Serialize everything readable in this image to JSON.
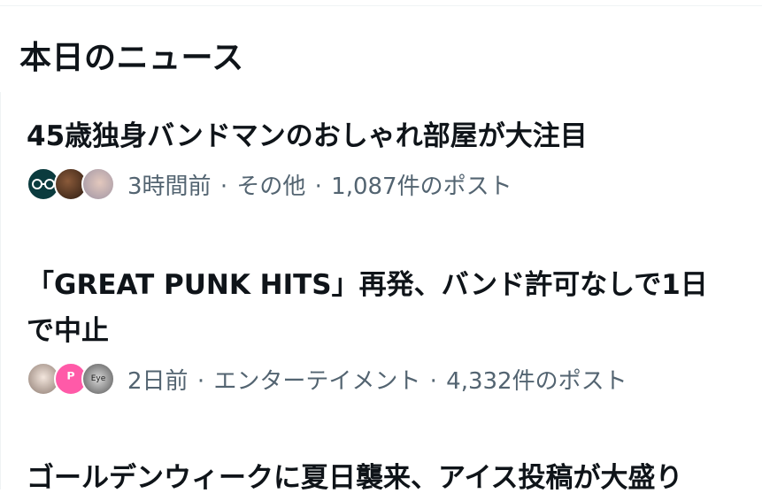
{
  "section": {
    "title": "本日のニュース"
  },
  "news": [
    {
      "headline_lines": [
        "45歳独身バンドマンのおしゃれ部屋が大注目"
      ],
      "time": "3時間前",
      "category": "その他",
      "posts": "1,087件のポスト",
      "avatar_colors": [
        "#0b3b3e",
        "#3a2a1e",
        "#b9b4bd"
      ]
    },
    {
      "headline_lines": [
        "「GREAT PUNK HITS」再発、バンド許可なしで1日",
        "で中止"
      ],
      "time": "2日前",
      "category": "エンターテイメント",
      "posts": "4,332件のポスト",
      "avatar_colors": [
        "#c9b8ad",
        "#ff5aa8",
        "#8a8a8a"
      ],
      "avatar_texts": [
        "",
        "ᴾ",
        "Eye"
      ]
    },
    {
      "headline_lines": [
        "ゴールデンウィークに夏日襲来、アイス投稿が大盛り"
      ]
    }
  ],
  "separator": "·"
}
